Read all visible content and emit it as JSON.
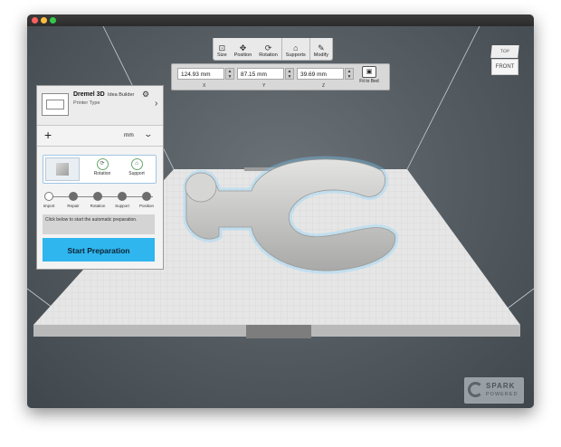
{
  "window": {
    "traffic_lights": [
      "close",
      "minimize",
      "zoom"
    ]
  },
  "toolbar": {
    "items": [
      {
        "label": "Size",
        "icon": "size-icon"
      },
      {
        "label": "Position",
        "icon": "position-icon"
      },
      {
        "label": "Rotation",
        "icon": "rotation-icon"
      },
      {
        "label": "Supports",
        "icon": "supports-icon"
      },
      {
        "label": "Modify",
        "icon": "modify-icon"
      }
    ]
  },
  "dimensions": {
    "x": {
      "value": "124.93 mm",
      "axis": "X"
    },
    "y": {
      "value": "87.15 mm",
      "axis": "Y"
    },
    "z": {
      "value": "39.69 mm",
      "axis": "Z"
    },
    "fit_label": "Fit to Bed"
  },
  "view_cube": {
    "top": "TOP",
    "front": "FRONT"
  },
  "panel": {
    "printer_name": "Dremel 3D",
    "printer_model": "Idea Builder",
    "printer_type": "Printer Type",
    "unit": "mm",
    "tools": [
      {
        "label": "Rotation",
        "icon": "rotation-icon"
      },
      {
        "label": "Support",
        "icon": "support-icon"
      }
    ],
    "steps": [
      "Import",
      "Repair",
      "Rotation",
      "Support",
      "Position"
    ],
    "message": "Click below to start the automatic preparation.",
    "start_button": "Start Preparation"
  },
  "branding": {
    "line1": "SPARK",
    "line2": "POWERED"
  },
  "colors": {
    "accent": "#2fb6ee",
    "background": "#50585e",
    "bed": "#e4e4e4",
    "model": "#c9c9c7"
  }
}
